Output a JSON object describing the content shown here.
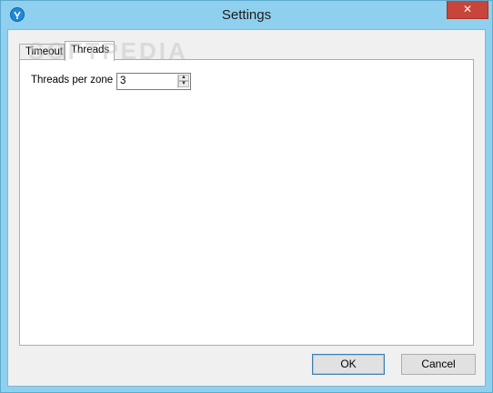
{
  "window": {
    "title": "Settings",
    "close_label": "✕"
  },
  "tabs": [
    {
      "label": "Timeout",
      "active": false
    },
    {
      "label": "Threads",
      "active": true
    }
  ],
  "threads": {
    "label": "Threads per zone",
    "value": "3"
  },
  "buttons": {
    "ok": "OK",
    "cancel": "Cancel"
  },
  "watermark": "SOFTPEDIA",
  "colors": {
    "frame": "#8fd0ef",
    "close": "#c7453b",
    "icon": "#1e88d8"
  }
}
